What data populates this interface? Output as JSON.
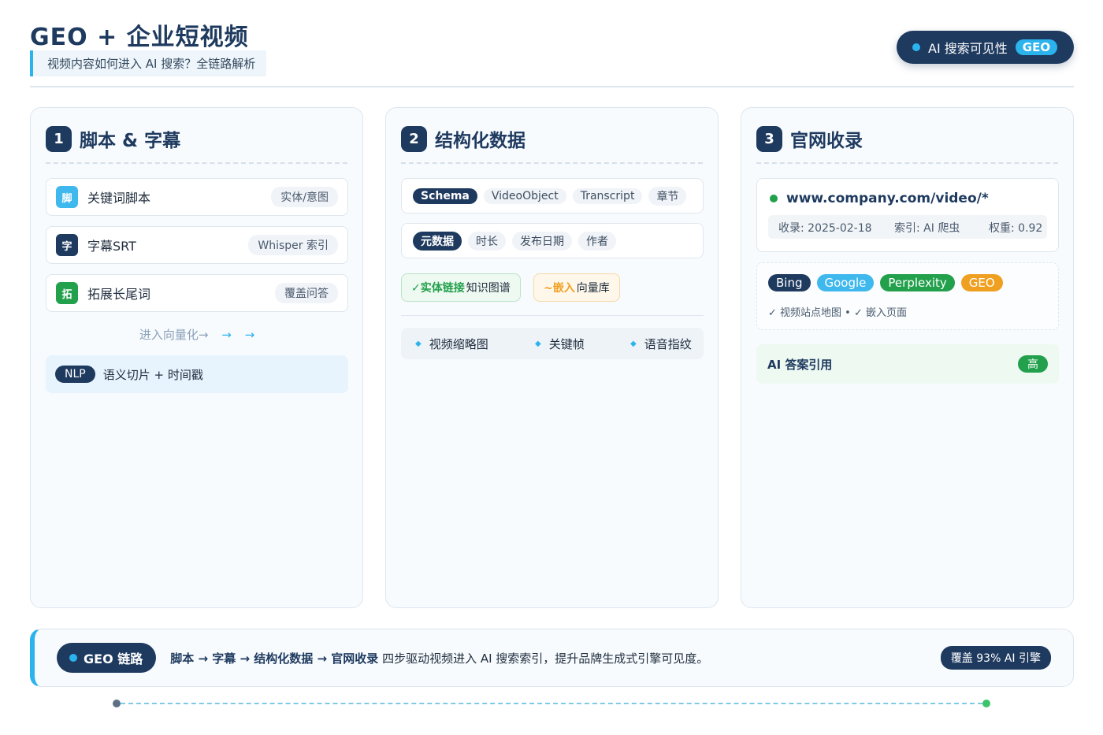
{
  "header": {
    "title": "GEO + 企业短视频",
    "subtitle": "视频内容如何进入 AI 搜索？全链路解析",
    "badge_label": "AI 搜索可见性",
    "badge_tag": "GEO"
  },
  "colors": {
    "navy": "#1e3a5f",
    "accent_blue": "#2bb3ee",
    "green": "#22a04b",
    "orange": "#f0a020"
  },
  "card1": {
    "num": "1",
    "title": "脚本 & 字幕",
    "rows": [
      {
        "icon": "脚",
        "label": "关键词脚本",
        "tag": "实体/意图"
      },
      {
        "icon": "字",
        "label": "字幕SRT",
        "tag": "Whisper 索引"
      },
      {
        "icon": "拓",
        "label": "拓展长尾词",
        "tag": "覆盖问答"
      }
    ],
    "flow_text": "进入向量化→",
    "flow_arrow": "→",
    "nlp_tag": "NLP",
    "nlp_label": "语义切片 + 时间戳"
  },
  "card2": {
    "num": "2",
    "title": "结构化数据",
    "schema_row": [
      "Schema",
      "VideoObject",
      "Transcript",
      "章节"
    ],
    "meta_row": [
      "元数据",
      "时长",
      "发布日期",
      "作者"
    ],
    "entity_bold": "✓实体链接",
    "entity_text": "知识图谱",
    "embed_bold": "~嵌入",
    "embed_text": "向量库",
    "features": [
      "视频缩略图",
      "关键帧",
      "语音指纹"
    ]
  },
  "card3": {
    "num": "3",
    "title": "官网收录",
    "url": "www.company.com/video/*",
    "meta": {
      "indexed": "收录: 2025-02-18",
      "crawler": "索引: AI 爬虫",
      "weight": "权重: 0.92"
    },
    "engines": [
      {
        "name": "Bing",
        "color": "#1e3a5f"
      },
      {
        "name": "Google",
        "color": "#3fb8ee"
      },
      {
        "name": "Perplexity",
        "color": "#22a04b"
      },
      {
        "name": "GEO",
        "color": "#f0a020"
      }
    ],
    "engines_note": "✓ 视频站点地图 • ✓ 嵌入页面",
    "cite_label": "AI 答案引用",
    "cite_level": "高"
  },
  "footer": {
    "pill": "GEO 链路",
    "steps_bold": "脚本 → 字幕 → 结构化数据 → 官网收录",
    "steps_text": "四步驱动视频进入 AI 搜索索引，提升品牌生成式引擎可见度。",
    "coverage": "覆盖 93% AI 引擎"
  }
}
